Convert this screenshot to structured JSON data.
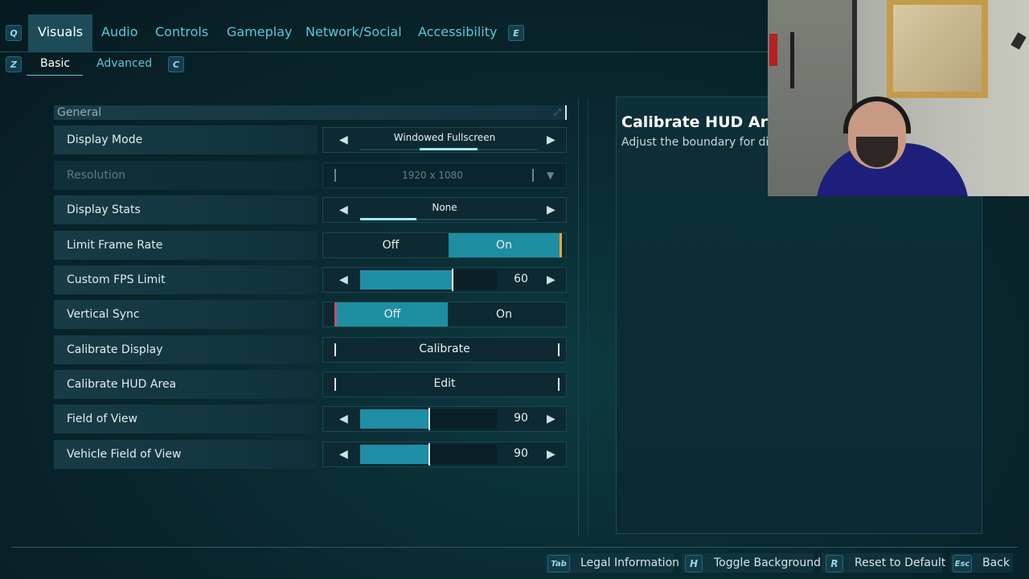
{
  "tabs": {
    "left_key": "Q",
    "right_key": "E",
    "items": [
      "Visuals",
      "Audio",
      "Controls",
      "Gameplay",
      "Network/Social",
      "Accessibility"
    ]
  },
  "subtabs": {
    "left_key": "Z",
    "right_key": "C",
    "items": [
      "Basic",
      "Advanced"
    ]
  },
  "section": "General",
  "settings": {
    "display_mode": {
      "label": "Display Mode",
      "value": "Windowed Fullscreen"
    },
    "resolution": {
      "label": "Resolution",
      "value": "1920 x 1080"
    },
    "display_stats": {
      "label": "Display Stats",
      "value": "None"
    },
    "limit_frame_rate": {
      "label": "Limit Frame Rate",
      "off": "Off",
      "on": "On",
      "selected": "On"
    },
    "custom_fps": {
      "label": "Custom FPS Limit",
      "value": "60",
      "fraction": 0.67
    },
    "vsync": {
      "label": "Vertical Sync",
      "off": "Off",
      "on": "On",
      "selected": "Off"
    },
    "calibrate_display": {
      "label": "Calibrate Display",
      "button": "Calibrate"
    },
    "calibrate_hud": {
      "label": "Calibrate HUD Area",
      "button": "Edit"
    },
    "fov": {
      "label": "Field of View",
      "value": "90",
      "fraction": 0.5
    },
    "vehicle_fov": {
      "label": "Vehicle Field of View",
      "value": "90",
      "fraction": 0.5
    }
  },
  "info": {
    "title": "Calibrate HUD Area",
    "description": "Adjust the boundary for dis"
  },
  "bottom": {
    "legal": {
      "key": "Tab",
      "label": "Legal Information"
    },
    "toggle_bg": {
      "key": "H",
      "label": "Toggle Background"
    },
    "reset": {
      "key": "R",
      "label": "Reset to Default"
    },
    "back": {
      "key": "Esc",
      "label": "Back"
    }
  },
  "colors": {
    "accent": "#1e8fa6",
    "tab_text": "#58c8e0",
    "background": "#0a2a31"
  }
}
